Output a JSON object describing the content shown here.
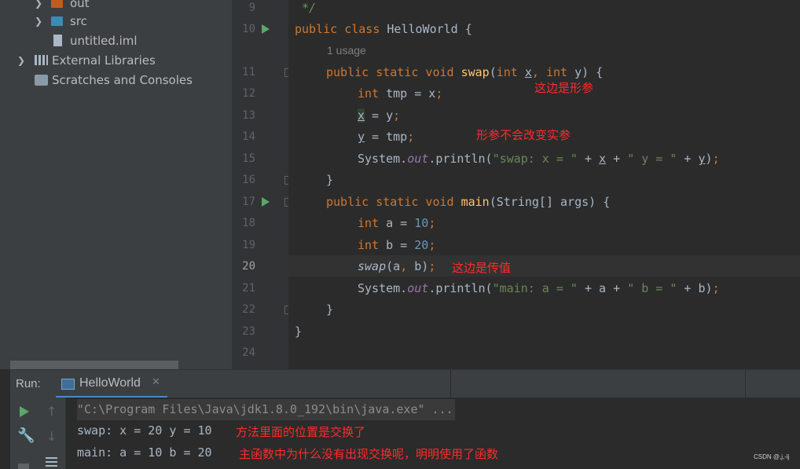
{
  "project_tree": [
    {
      "label": "out",
      "type": "folder-orange",
      "indent": 1
    },
    {
      "label": "src",
      "type": "folder-blue",
      "indent": 1
    },
    {
      "label": "untitled.iml",
      "type": "file",
      "indent": 2
    },
    {
      "label": "External Libraries",
      "type": "libs",
      "indent": 0
    },
    {
      "label": "Scratches and Consoles",
      "type": "scratch",
      "indent": 0
    }
  ],
  "editor": {
    "line_numbers": [
      "9",
      "10",
      "11",
      "12",
      "13",
      "14",
      "15",
      "16",
      "17",
      "18",
      "19",
      "20",
      "21",
      "22",
      "23",
      "24"
    ],
    "current_line": "20",
    "usage_hint": "1 usage",
    "lines": {
      "l9": "*/",
      "l10": "public class HelloWorld {",
      "l11": "public static void swap(int x, int y) {",
      "l12": "int tmp = x;",
      "l13": "x = y;",
      "l14": "y = tmp;",
      "l15": "System.out.println(\"swap: x = \" + x + \" y = \" + y);",
      "l16": "}",
      "l17": "public static void main(String[] args) {",
      "l18": "int a = 10;",
      "l19": "int b = 20;",
      "l20": "swap(a, b);",
      "l21": "System.out.println(\"main: a = \" + a + \" b = \" + b);",
      "l22": "}",
      "l23": "}"
    }
  },
  "annotations": {
    "formal_params": "这边是形参",
    "no_change": "形参不会改变实参",
    "pass_value": "这边是传值",
    "swap_note": "方法里面的位置是交换了",
    "main_note": "主函数中为什么没有出现交换呢，明明使用了函数"
  },
  "run": {
    "label": "Run:",
    "tab_name": "HelloWorld",
    "command": "\"C:\\Program Files\\Java\\jdk1.8.0_192\\bin\\java.exe\" ...",
    "output": [
      "swap: x = 20 y = 10",
      "main: a = 10 b = 20"
    ]
  },
  "watermark": "CSDN @,j,-lj",
  "colors": {
    "keyword": "#cc7832",
    "function": "#ffc66d",
    "string": "#6a8759",
    "number": "#6897bb",
    "annotation": "#ff2b2b",
    "run_green": "#59a869"
  }
}
